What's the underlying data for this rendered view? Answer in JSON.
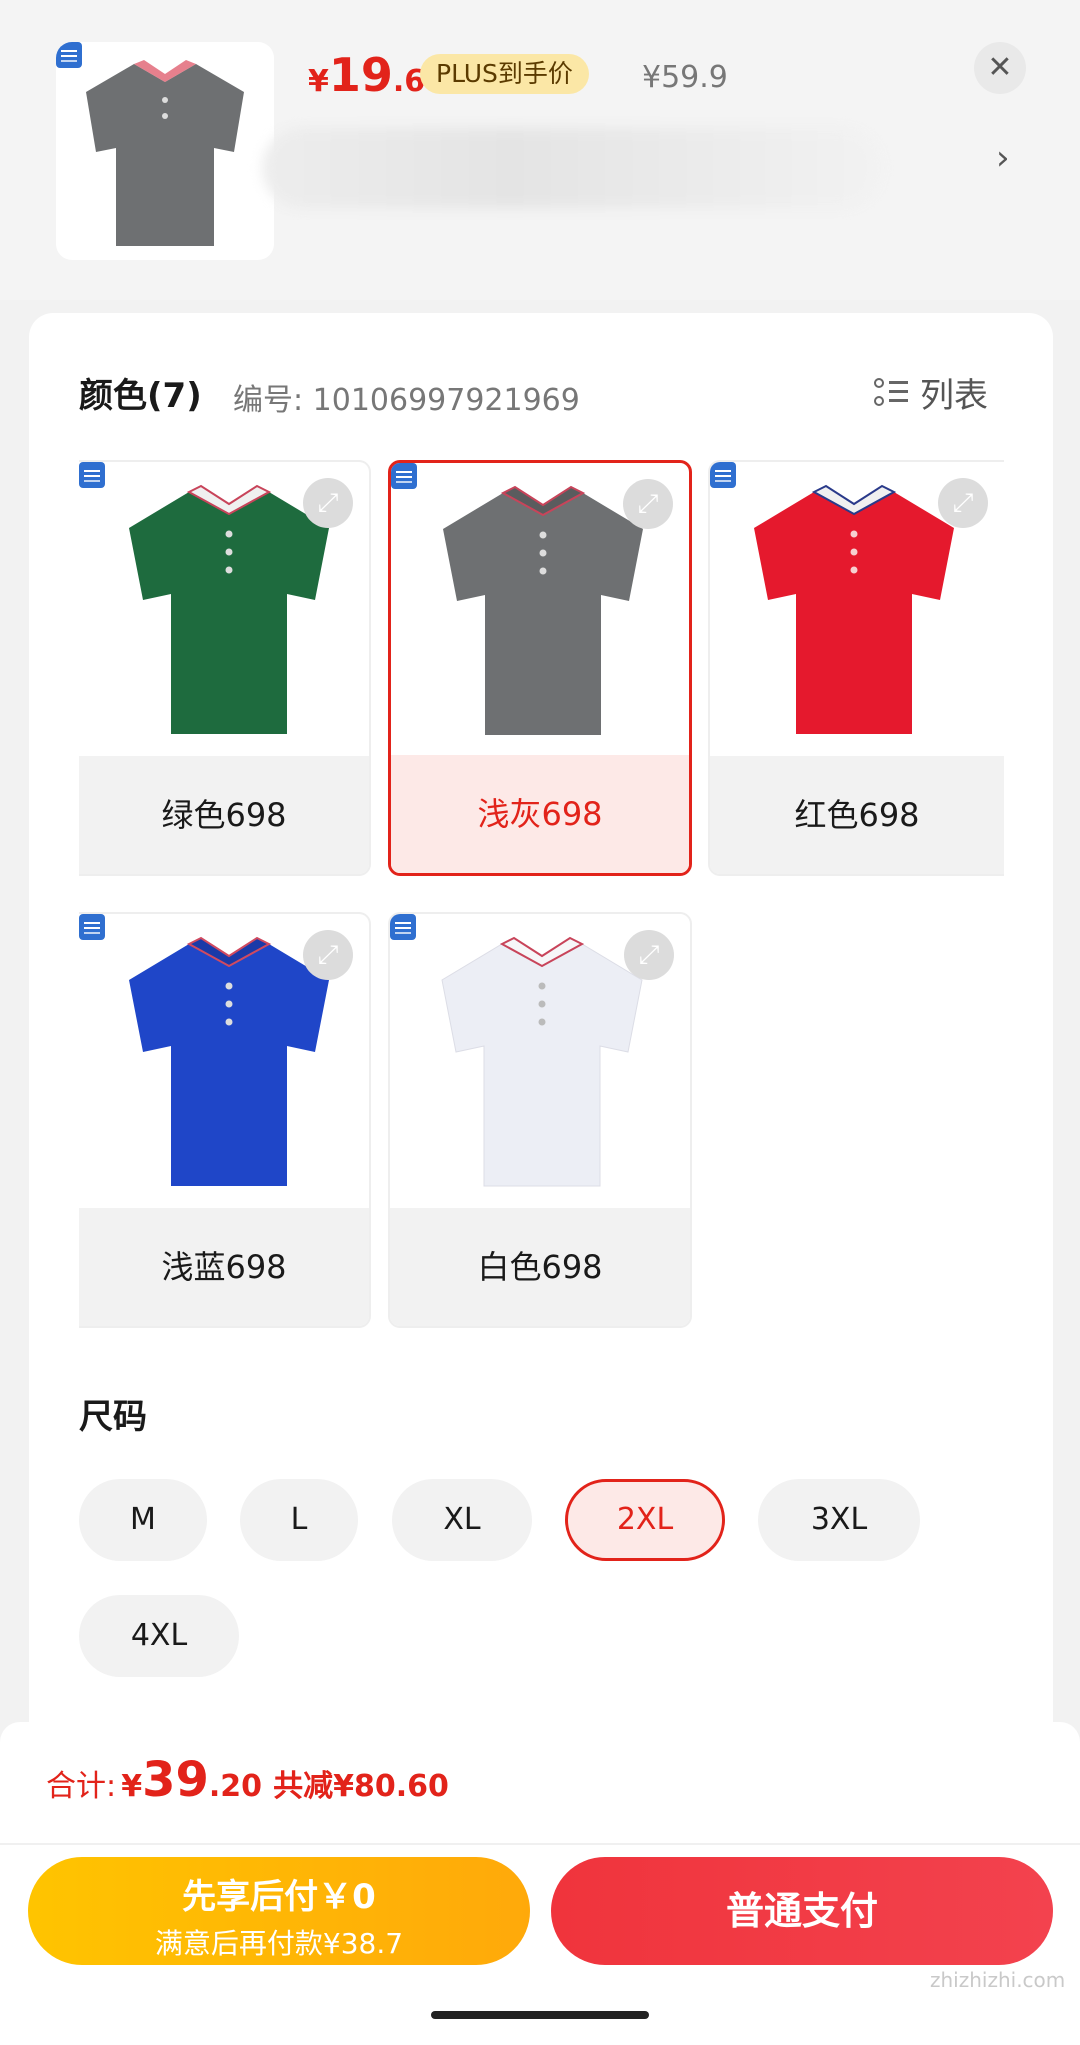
{
  "header": {
    "price": {
      "currency": "¥",
      "integer": "19",
      "decimal": ".6"
    },
    "plus_badge": "PLUS到手价",
    "original_price": "¥59.9",
    "close_icon": "close-icon",
    "chevron_icon": "chevron-right-icon"
  },
  "colors": {
    "title": "颜色(7)",
    "sku_label": "编号: 10106997921969",
    "list_label": "列表",
    "items": [
      {
        "label": "绿色698",
        "shirt": "#1e6b3e",
        "selected": false
      },
      {
        "label": "浅灰698",
        "shirt": "#6e7072",
        "selected": true
      },
      {
        "label": "红色698",
        "shirt": "#e5192d",
        "selected": false
      },
      {
        "label": "浅蓝698",
        "shirt": "#1f46c8",
        "selected": false
      },
      {
        "label": "白色698",
        "shirt": "#eceef5",
        "selected": false
      }
    ]
  },
  "sizes": {
    "title": "尺码",
    "items": [
      "M",
      "L",
      "XL",
      "2XL",
      "3XL",
      "4XL"
    ],
    "selected": "2XL"
  },
  "summary": {
    "label": "合计:",
    "currency": "¥",
    "integer": "39",
    "decimal": ".20",
    "saving": "共减¥80.60"
  },
  "actions": {
    "pay_later_line1": "先享后付￥0",
    "pay_later_line2": "满意后再付款¥38.7",
    "pay_normal": "普通支付"
  },
  "watermark": "zhizhizhi.com",
  "accent_color": "#e2231a"
}
